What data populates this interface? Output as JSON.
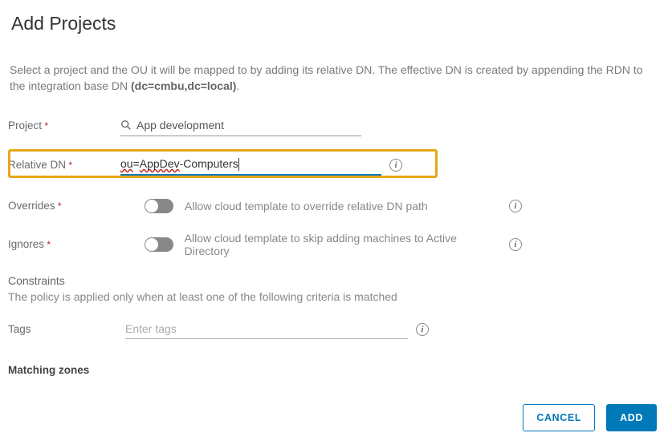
{
  "title": "Add Projects",
  "description_prefix": "Select a project and the OU it will be mapped to by adding its relative DN. The effective DN is created by appending the RDN to the integration base DN ",
  "description_bold": "(dc=cmbu,dc=local)",
  "description_suffix": ".",
  "project": {
    "label": "Project",
    "value": "App development"
  },
  "relative_dn": {
    "label": "Relative DN",
    "value": "ou=AppDev-Computers",
    "p1": "ou",
    "p2": "=",
    "p3": "AppDev",
    "p4": "-Computers"
  },
  "overrides": {
    "label": "Overrides",
    "text": "Allow cloud template to override relative DN path",
    "on": false
  },
  "ignores": {
    "label": "Ignores",
    "text": "Allow cloud template to skip adding machines to Active Directory",
    "on": false
  },
  "constraints_head": "Constraints",
  "constraints_desc": "The policy is applied only when at least one of the following criteria is matched",
  "tags": {
    "label": "Tags",
    "placeholder": "Enter tags",
    "value": ""
  },
  "matching_zones_label": "Matching zones",
  "buttons": {
    "cancel": "CANCEL",
    "add": "ADD"
  }
}
